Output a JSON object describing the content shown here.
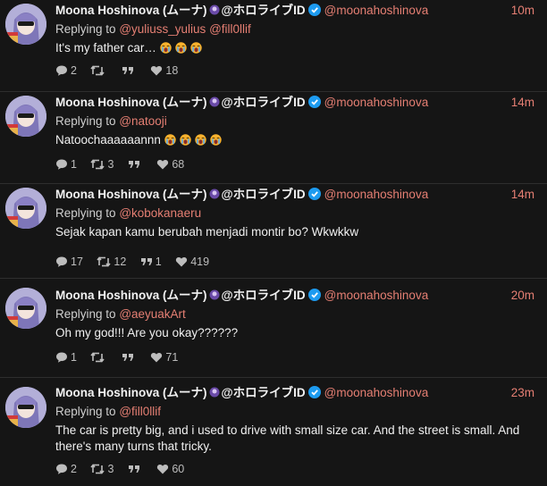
{
  "colors": {
    "accent": "#e57f73",
    "background": "#151515",
    "verified": "#1d9bf0"
  },
  "icons": [
    "reply-icon",
    "retweet-icon",
    "quote-icon",
    "like-icon",
    "verified-icon",
    "crying-emoji",
    "purple-emoji"
  ],
  "tweets": [
    {
      "name": "Moona Hoshinova (ムーナ)",
      "suffix": "@ホロライブID",
      "handle": "@moonahoshinova",
      "time": "10m",
      "reply_prefix": "Replying to",
      "reply_to": [
        "@yuliuss_yulius",
        "@fill0llif"
      ],
      "text": "It's my father car…",
      "emoji_count": 3,
      "replies": "2",
      "retweets": "",
      "quotes": "",
      "likes": "18"
    },
    {
      "name": "Moona Hoshinova (ムーナ)",
      "suffix": "@ホロライブID",
      "handle": "@moonahoshinova",
      "time": "14m",
      "reply_prefix": "Replying to",
      "reply_to": [
        "@natooji"
      ],
      "text": "Natoochaaaaaannn",
      "emoji_count": 4,
      "replies": "1",
      "retweets": "3",
      "quotes": "",
      "likes": "68"
    },
    {
      "name": "Moona Hoshinova (ムーナ)",
      "suffix": "@ホロライブID",
      "handle": "@moonahoshinova",
      "time": "14m",
      "reply_prefix": "Replying to",
      "reply_to": [
        "@kobokanaeru"
      ],
      "text": "Sejak kapan kamu berubah menjadi montir bo? Wkwkkw",
      "emoji_count": 0,
      "replies": "17",
      "retweets": "12",
      "quotes": "1",
      "likes": "419"
    },
    {
      "name": "Moona Hoshinova (ムーナ)",
      "suffix": "@ホロライブID",
      "handle": "@moonahoshinova",
      "time": "20m",
      "reply_prefix": "Replying to",
      "reply_to": [
        "@aeyuakArt"
      ],
      "text": "Oh my god!!! Are you okay??????",
      "emoji_count": 0,
      "replies": "1",
      "retweets": "",
      "quotes": "",
      "likes": "71"
    },
    {
      "name": "Moona Hoshinova (ムーナ)",
      "suffix": "@ホロライブID",
      "handle": "@moonahoshinova",
      "time": "23m",
      "reply_prefix": "Replying to",
      "reply_to": [
        "@fill0llif"
      ],
      "text": "The car is pretty big, and i used to drive with small size car. And the street is small. And there's many turns that tricky.",
      "emoji_count": 0,
      "replies": "2",
      "retweets": "3",
      "quotes": "",
      "likes": "60"
    }
  ]
}
